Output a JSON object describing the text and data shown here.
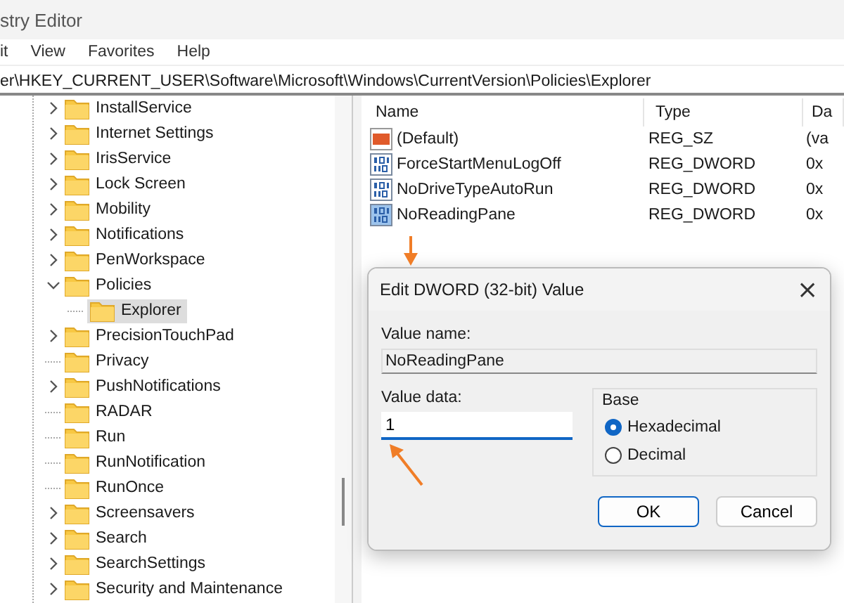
{
  "window": {
    "title": "stry Editor"
  },
  "menu": [
    "it",
    "View",
    "Favorites",
    "Help"
  ],
  "address": "er\\HKEY_CURRENT_USER\\Software\\Microsoft\\Windows\\CurrentVersion\\Policies\\Explorer",
  "tree": [
    {
      "label": "InstallService",
      "expanded": false,
      "selected": false
    },
    {
      "label": "Internet Settings",
      "expanded": false,
      "selected": false
    },
    {
      "label": "IrisService",
      "expanded": false,
      "selected": false
    },
    {
      "label": "Lock Screen",
      "expanded": false,
      "selected": false
    },
    {
      "label": "Mobility",
      "expanded": false,
      "selected": false
    },
    {
      "label": "Notifications",
      "expanded": false,
      "selected": false
    },
    {
      "label": "PenWorkspace",
      "expanded": false,
      "selected": false
    },
    {
      "label": "Policies",
      "expanded": true,
      "selected": false,
      "children": [
        {
          "label": "Explorer",
          "selected": true
        }
      ]
    },
    {
      "label": "PrecisionTouchPad",
      "expanded": false,
      "selected": false
    },
    {
      "label": "Privacy",
      "selected": false
    },
    {
      "label": "PushNotifications",
      "expanded": false,
      "selected": false
    },
    {
      "label": "RADAR",
      "selected": false
    },
    {
      "label": "Run",
      "selected": false
    },
    {
      "label": "RunNotification",
      "selected": false
    },
    {
      "label": "RunOnce",
      "selected": false
    },
    {
      "label": "Screensavers",
      "expanded": false,
      "selected": false
    },
    {
      "label": "Search",
      "expanded": false,
      "selected": false
    },
    {
      "label": "SearchSettings",
      "expanded": false,
      "selected": false
    },
    {
      "label": "Security and Maintenance",
      "expanded": false,
      "selected": false
    }
  ],
  "table": {
    "columns": [
      "Name",
      "Type",
      "Da"
    ],
    "rows": [
      {
        "kind": "string",
        "name": "(Default)",
        "type": "REG_SZ",
        "data": "(va",
        "selected": false
      },
      {
        "kind": "binary",
        "name": "ForceStartMenuLogOff",
        "type": "REG_DWORD",
        "data": "0x",
        "selected": false
      },
      {
        "kind": "binary",
        "name": "NoDriveTypeAutoRun",
        "type": "REG_DWORD",
        "data": "0x",
        "selected": false
      },
      {
        "kind": "binary",
        "name": "NoReadingPane",
        "type": "REG_DWORD",
        "data": "0x",
        "selected": true
      }
    ]
  },
  "dialog": {
    "title": "Edit DWORD (32-bit) Value",
    "close": "×",
    "name_label": "Value name:",
    "name_value": "NoReadingPane",
    "data_label": "Value data:",
    "data_value": "1",
    "base_label": "Base",
    "base_options": [
      {
        "label": "Hexadecimal",
        "selected": true
      },
      {
        "label": "Decimal",
        "selected": false
      }
    ],
    "buttons": [
      {
        "label": "OK",
        "default": true
      },
      {
        "label": "Cancel",
        "default": false
      }
    ]
  }
}
